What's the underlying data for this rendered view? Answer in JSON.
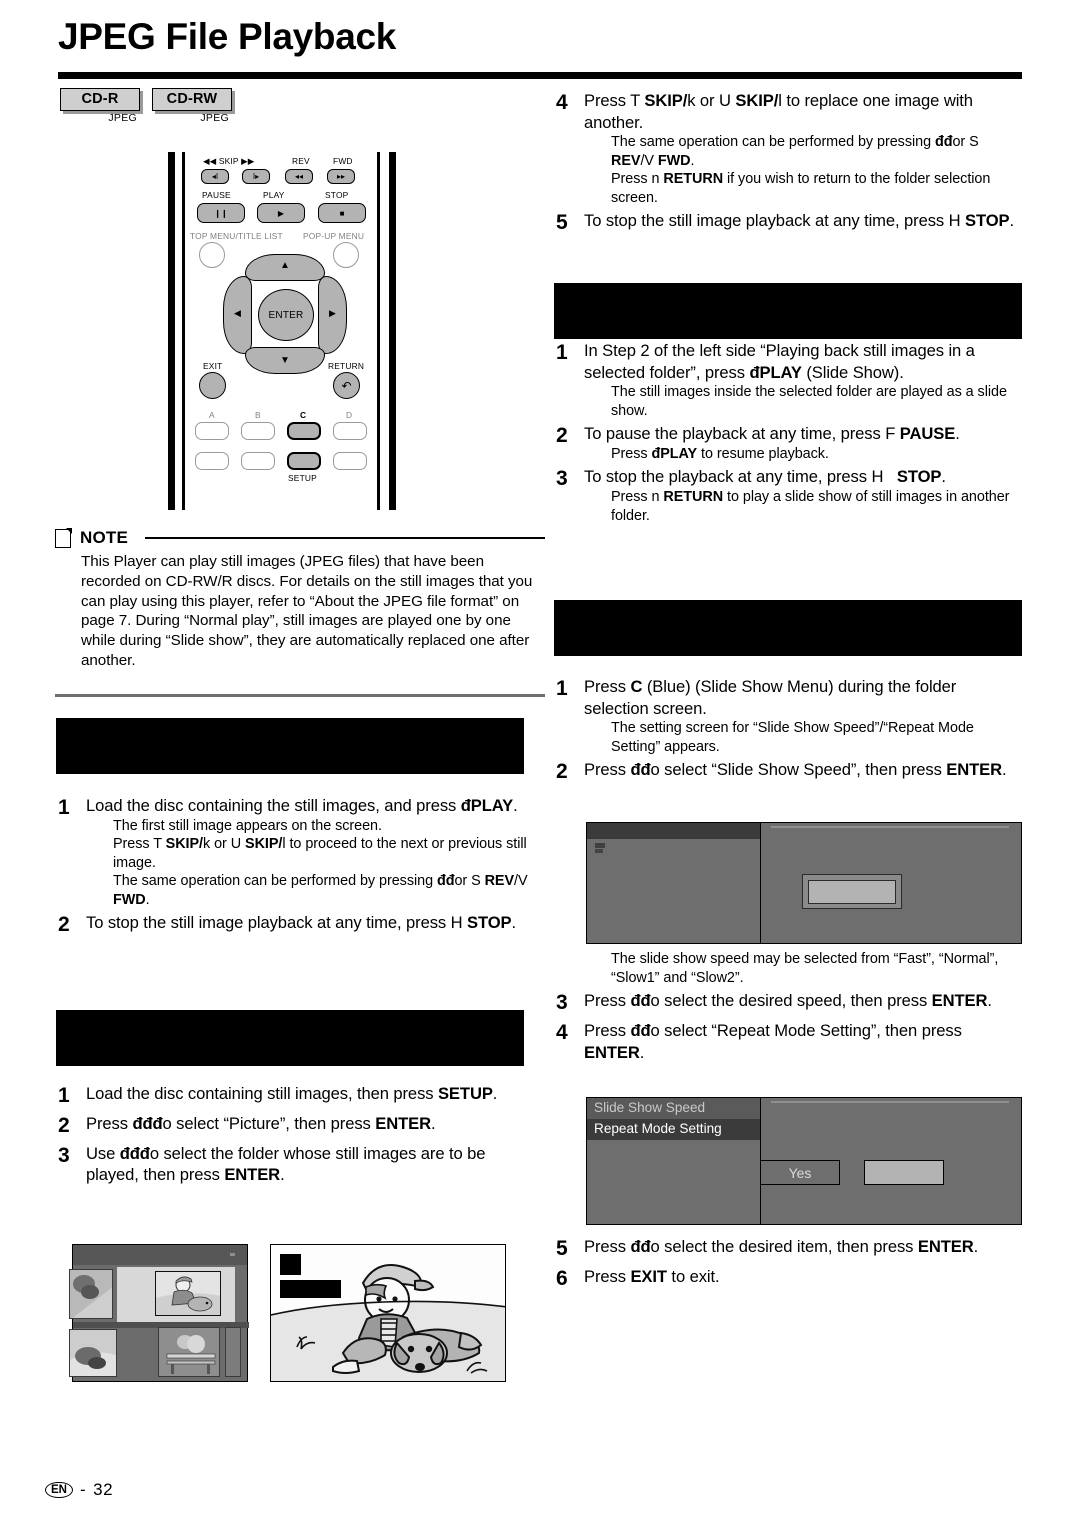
{
  "page": {
    "title": "JPEG File Playback",
    "footer_locale": "EN",
    "footer_separator": "-",
    "footer_page": "32"
  },
  "disc_badges": [
    {
      "label": "CD-R",
      "format": "JPEG"
    },
    {
      "label": "CD-RW",
      "format": "JPEG"
    }
  ],
  "remote": {
    "labels": {
      "skip": "SKIP",
      "skip_prev_glyph": "◀◀",
      "skip_next_glyph": "▶▶",
      "rev": "REV",
      "fwd": "FWD",
      "pause": "PAUSE",
      "play": "PLAY",
      "stop": "STOP",
      "top_menu": "TOP MENU/TITLE LIST",
      "popup_menu": "POP-UP MENU",
      "enter": "ENTER",
      "exit": "EXIT",
      "return": "RETURN",
      "color_a": "A",
      "color_b": "B",
      "color_c": "C",
      "color_d": "D",
      "setup": "SETUP"
    },
    "glyphs": {
      "skip_prev": "◂I",
      "skip_next": "I▸",
      "rev": "◂◂",
      "fwd": "▸▸",
      "pause": "❙❙",
      "play": "▶",
      "stop": "■",
      "up": "▲",
      "down": "▼",
      "left": "◀",
      "right": "▶",
      "return": "↶"
    }
  },
  "note": {
    "title": "NOTE",
    "body": "This Player can play still images (JPEG files) that have been recorded on CD-RW/R discs. For details on the still images that you can play using this player, refer to “About the JPEG file format” on page 7. During “Normal play”, still images are played one by one while during “Slide show”, they are automatically replaced one after another."
  },
  "sections": {
    "left_section_1_heading": "",
    "left_section_2_heading": "",
    "right_section_1_heading": "",
    "right_section_2_heading": ""
  },
  "left_column": {
    "section1_steps": [
      {
        "num": "1",
        "main_html": "Load the disc containing the still images, and press <b>đPLAY</b>.",
        "subs_html": [
          "The first still image appears on the screen.",
          "Press T <b>SKIP/</b>k or U <b>SKIP/</b>l to proceed to the next or previous still image.",
          "The same operation can be performed by pressing <b>đđ</b>or S <b>REV</b>/V <b>FWD</b>."
        ]
      },
      {
        "num": "2",
        "main_html": "To stop the still image playback at any time, press H <b>STOP</b>.",
        "subs_html": []
      }
    ],
    "section2_steps": [
      {
        "num": "1",
        "main_html": "Load the disc containing still images, then press <b>SETUP</b>.",
        "subs_html": []
      },
      {
        "num": "2",
        "main_html": "Press <b>đđđ</b>o select “Picture”, then press <b>ENTER</b>.",
        "subs_html": []
      },
      {
        "num": "3",
        "main_html": "Use <b>đđđ</b>o select the folder whose still images are to be played, then press <b>ENTER</b>.",
        "subs_html": []
      }
    ]
  },
  "right_column": {
    "top_steps": [
      {
        "num": "4",
        "main_html": "Press T <b>SKIP/</b>k or U <b>SKIP/</b>l to replace one image with another.",
        "subs_html": [
          "The same operation can be performed by pressing <b>đđ</b>or S <b>REV</b>/V <b>FWD</b>.",
          "Press n <b>RETURN</b> if you wish to return to the folder selection screen."
        ]
      },
      {
        "num": "5",
        "main_html": "To stop the still image playback at any time, press H <b>STOP</b>.",
        "subs_html": []
      }
    ],
    "section1_steps": [
      {
        "num": "1",
        "main_html": "In Step 2 of the left side “Playing back still images in a selected folder”, press <b>đPLAY</b> (Slide Show).",
        "subs_html": [
          "The still images inside the selected folder are played as a slide show."
        ]
      },
      {
        "num": "2",
        "main_html": "To pause the playback at any time, press F <b>PAUSE</b>.",
        "subs_html": [
          "Press <b>đPLAY</b> to resume playback."
        ]
      },
      {
        "num": "3",
        "main_html": "To stop the playback at any time, press H&nbsp;&nbsp;&nbsp;<b>STOP</b>.",
        "subs_html": [
          "Press n <b>RETURN</b> to play a slide show of still images in another folder."
        ]
      }
    ],
    "section2_steps_a": [
      {
        "num": "1",
        "main_html": "Press <b>C</b> (Blue) (Slide Show Menu) during the folder selection screen.",
        "subs_html": [
          "The setting screen for “Slide Show Speed”/“Repeat Mode Setting” appears."
        ]
      },
      {
        "num": "2",
        "main_html": "Press <b>đđ</b>o select “Slide Show Speed”, then press <b>ENTER</b>.",
        "subs_html": []
      }
    ],
    "section2_steps_b": [
      {
        "num": "",
        "main_html": "",
        "subs_html": [
          "The slide show speed may be selected from “Fast”, “Normal”, “Slow1” and “Slow2”."
        ]
      },
      {
        "num": "3",
        "main_html": "Press <b>đđ</b>o select the desired speed, then press <b>ENTER</b>.",
        "subs_html": []
      },
      {
        "num": "4",
        "main_html": "Press <b>đđ</b>o select “Repeat Mode Setting”, then press <b>ENTER</b>.",
        "subs_html": []
      }
    ],
    "section2_steps_c": [
      {
        "num": "5",
        "main_html": "Press <b>đđ</b>o select the desired item, then press <b>ENTER</b>.",
        "subs_html": []
      },
      {
        "num": "6",
        "main_html": "Press <b>EXIT</b> to exit.",
        "subs_html": []
      }
    ]
  },
  "osd_screen_1": {
    "menu_items": [],
    "note": "unreadable / obscured menu text"
  },
  "osd_screen_2": {
    "menu_items": [
      {
        "label": "Slide Show Speed",
        "state": "dim"
      },
      {
        "label": "Repeat Mode Setting",
        "state": "highlighted"
      }
    ],
    "buttons": [
      {
        "label": "Yes",
        "state": "plain"
      },
      {
        "label": "",
        "state": "selected"
      }
    ]
  },
  "colors": {
    "rule": "#000000",
    "section_bar": "#000000",
    "chip_fill": "#cfcfcf",
    "osd_bg": "#6e6e6e",
    "osd_highlight": "#3b3b3b",
    "osd_selected": "#b3b3b3"
  }
}
